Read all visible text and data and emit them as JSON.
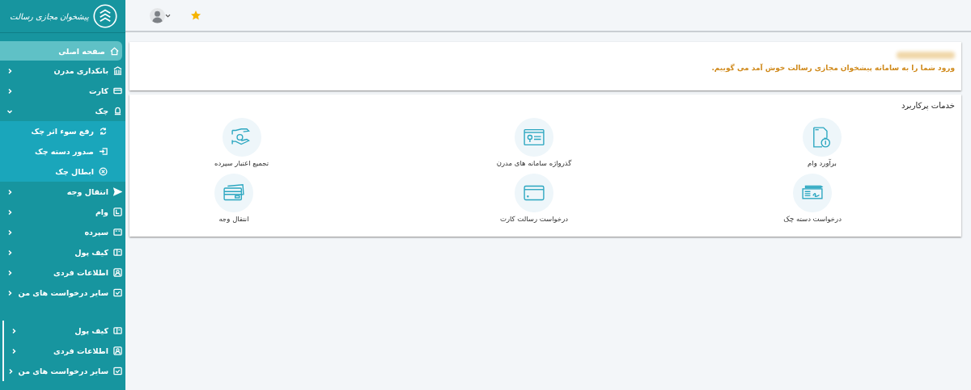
{
  "sidebar": {
    "logo_text": "پیشخوان مجازی رسالت",
    "items": [
      {
        "label": "صفحه اصلی",
        "kind": "link",
        "selected": true
      },
      {
        "label": "بانکداری مدرن",
        "kind": "group",
        "selected": false,
        "expanded": false
      },
      {
        "label": "کارت",
        "kind": "group",
        "selected": false,
        "expanded": false
      },
      {
        "label": "چک",
        "kind": "group",
        "selected": false,
        "expanded": true,
        "children": [
          {
            "label": "رفع سوء اثر چک",
            "selected": false
          },
          {
            "label": "صدور دسته چک",
            "selected": false
          },
          {
            "label": "ابطال چک",
            "selected": false
          }
        ]
      },
      {
        "label": "انتقال وجه",
        "kind": "group",
        "selected": false,
        "expanded": false
      },
      {
        "label": "وام",
        "kind": "group",
        "selected": false,
        "expanded": false
      },
      {
        "label": "سپرده",
        "kind": "group",
        "selected": false,
        "expanded": false
      },
      {
        "label": "کیف پول",
        "kind": "group",
        "selected": false,
        "expanded": false
      },
      {
        "label": "اطلاعات فردی",
        "kind": "group",
        "selected": false,
        "expanded": false
      },
      {
        "label": "سایر درخواست های من",
        "kind": "group",
        "selected": false,
        "expanded": false
      }
    ],
    "extra_items": [
      {
        "label": "کیف پول",
        "kind": "group",
        "selected": false,
        "expanded": false
      },
      {
        "label": "اطلاعات فردی",
        "kind": "group",
        "selected": false,
        "expanded": false
      },
      {
        "label": "سایر درخواست های من",
        "kind": "group",
        "selected": false,
        "expanded": false
      }
    ]
  },
  "welcome": {
    "message": "ورود شما را به سامانه پیشخوان مجازی رسالت خوش آمد می گوییم."
  },
  "services": {
    "title": "خدمات پرکاربرد",
    "tiles": [
      {
        "label": "برآورد وام"
      },
      {
        "label": "گذرواژه سامانه های مدرن"
      },
      {
        "label": "تجمیع اعتبار سپرده"
      },
      {
        "label": "درخواست دسته چک"
      },
      {
        "label": "درخواست رسالت کارت"
      },
      {
        "label": "انتقال وجه"
      }
    ]
  }
}
